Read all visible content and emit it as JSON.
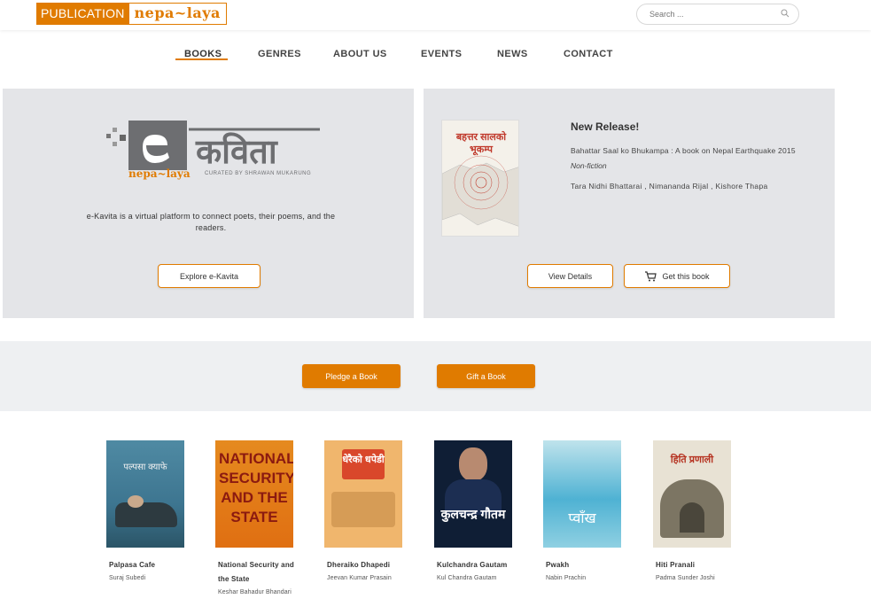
{
  "header": {
    "logo_left": "PUBLICATION",
    "logo_right": "nepa~laya",
    "search_placeholder": "Search ..."
  },
  "nav": {
    "items": [
      {
        "label": "BOOKS"
      },
      {
        "label": "GENRES"
      },
      {
        "label": "ABOUT US"
      },
      {
        "label": "EVENTS"
      },
      {
        "label": "NEWS"
      },
      {
        "label": "CONTACT"
      }
    ],
    "active": "BOOKS"
  },
  "ekavita": {
    "logo_text": "कविता",
    "logo_sub_brand": "nepa~laya",
    "logo_curated": "CURATED BY SHRAWAN MUKARUNG",
    "description": "e-Kavita is a virtual platform to connect poets, their poems, and the readers.",
    "button": "Explore e-Kavita"
  },
  "new_release": {
    "heading": "New Release!",
    "book": "Bahattar Saal ko Bhukampa : A book on Nepal Earthquake 2015",
    "genre": "Non-fiction",
    "authors": "Tara Nidhi Bhattarai , Nimananda Rijal , Kishore Thapa",
    "cover_title": "बहत्तर सालको भूकम्प",
    "details_button": "View Details",
    "get_button": "Get this book"
  },
  "actions": {
    "pledge": "Pledge a Book",
    "gift": "Gift a Book"
  },
  "books": [
    {
      "title": "Palpasa Cafe",
      "author": "Suraj Subedi",
      "cover_text": "पल्पसा क्याफे"
    },
    {
      "title": "National Security and the State",
      "author": "Keshar Bahadur Bhandari",
      "cover_text": "NATIONAL SECURITY AND THE STATE"
    },
    {
      "title": "Dheraiko Dhapedi",
      "author": "Jeevan Kumar Prasain",
      "cover_text": "धेरैको धपेडी"
    },
    {
      "title": "Kulchandra Gautam",
      "author": "Kul Chandra Gautam",
      "cover_text": "कुलचन्द्र गौतम"
    },
    {
      "title": "Pwakh",
      "author": "Nabin Prachin",
      "cover_text": "प्वाँख"
    },
    {
      "title": "Hiti Pranali",
      "author": "Padma Sunder Joshi",
      "cover_text": "हिति प्रणाली"
    }
  ],
  "colors": {
    "accent": "#e07b00",
    "panel_bg": "#e4e5e8",
    "strip_bg": "#eef0f2"
  }
}
